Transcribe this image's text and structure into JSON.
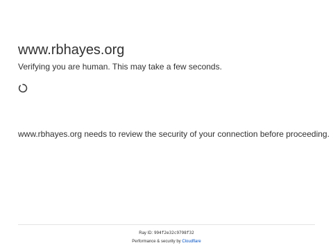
{
  "header": {
    "domain": "www.rbhayes.org",
    "verifying": "Verifying you are human. This may take a few seconds."
  },
  "spinner": {
    "icon": "loading-spinner-icon"
  },
  "main": {
    "review_message": "www.rbhayes.org needs to review the security of your connection before proceeding."
  },
  "footer": {
    "ray_label": "Ray ID:",
    "ray_id": "994f2e32c9798f32",
    "performance_label": "Performance & security by",
    "cloudflare_link": "Cloudflare"
  },
  "colors": {
    "text": "#313131",
    "link": "#0051c3",
    "divider": "#e4e4e4",
    "spinner": "#404040"
  }
}
